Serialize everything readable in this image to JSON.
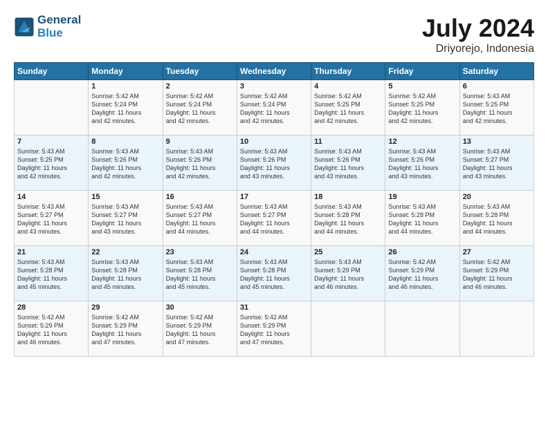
{
  "header": {
    "logo_line1": "General",
    "logo_line2": "Blue",
    "month_year": "July 2024",
    "location": "Driyorejo, Indonesia"
  },
  "days_of_week": [
    "Sunday",
    "Monday",
    "Tuesday",
    "Wednesday",
    "Thursday",
    "Friday",
    "Saturday"
  ],
  "weeks": [
    [
      {
        "day": "",
        "info": ""
      },
      {
        "day": "1",
        "info": "Sunrise: 5:42 AM\nSunset: 5:24 PM\nDaylight: 11 hours\nand 42 minutes."
      },
      {
        "day": "2",
        "info": "Sunrise: 5:42 AM\nSunset: 5:24 PM\nDaylight: 11 hours\nand 42 minutes."
      },
      {
        "day": "3",
        "info": "Sunrise: 5:42 AM\nSunset: 5:24 PM\nDaylight: 11 hours\nand 42 minutes."
      },
      {
        "day": "4",
        "info": "Sunrise: 5:42 AM\nSunset: 5:25 PM\nDaylight: 11 hours\nand 42 minutes."
      },
      {
        "day": "5",
        "info": "Sunrise: 5:42 AM\nSunset: 5:25 PM\nDaylight: 11 hours\nand 42 minutes."
      },
      {
        "day": "6",
        "info": "Sunrise: 5:43 AM\nSunset: 5:25 PM\nDaylight: 11 hours\nand 42 minutes."
      }
    ],
    [
      {
        "day": "7",
        "info": "Sunrise: 5:43 AM\nSunset: 5:25 PM\nDaylight: 11 hours\nand 42 minutes."
      },
      {
        "day": "8",
        "info": "Sunrise: 5:43 AM\nSunset: 5:26 PM\nDaylight: 11 hours\nand 42 minutes."
      },
      {
        "day": "9",
        "info": "Sunrise: 5:43 AM\nSunset: 5:26 PM\nDaylight: 11 hours\nand 42 minutes."
      },
      {
        "day": "10",
        "info": "Sunrise: 5:43 AM\nSunset: 5:26 PM\nDaylight: 11 hours\nand 43 minutes."
      },
      {
        "day": "11",
        "info": "Sunrise: 5:43 AM\nSunset: 5:26 PM\nDaylight: 11 hours\nand 43 minutes."
      },
      {
        "day": "12",
        "info": "Sunrise: 5:43 AM\nSunset: 5:26 PM\nDaylight: 11 hours\nand 43 minutes."
      },
      {
        "day": "13",
        "info": "Sunrise: 5:43 AM\nSunset: 5:27 PM\nDaylight: 11 hours\nand 43 minutes."
      }
    ],
    [
      {
        "day": "14",
        "info": "Sunrise: 5:43 AM\nSunset: 5:27 PM\nDaylight: 11 hours\nand 43 minutes."
      },
      {
        "day": "15",
        "info": "Sunrise: 5:43 AM\nSunset: 5:27 PM\nDaylight: 11 hours\nand 43 minutes."
      },
      {
        "day": "16",
        "info": "Sunrise: 5:43 AM\nSunset: 5:27 PM\nDaylight: 11 hours\nand 44 minutes."
      },
      {
        "day": "17",
        "info": "Sunrise: 5:43 AM\nSunset: 5:27 PM\nDaylight: 11 hours\nand 44 minutes."
      },
      {
        "day": "18",
        "info": "Sunrise: 5:43 AM\nSunset: 5:28 PM\nDaylight: 11 hours\nand 44 minutes."
      },
      {
        "day": "19",
        "info": "Sunrise: 5:43 AM\nSunset: 5:28 PM\nDaylight: 11 hours\nand 44 minutes."
      },
      {
        "day": "20",
        "info": "Sunrise: 5:43 AM\nSunset: 5:28 PM\nDaylight: 11 hours\nand 44 minutes."
      }
    ],
    [
      {
        "day": "21",
        "info": "Sunrise: 5:43 AM\nSunset: 5:28 PM\nDaylight: 11 hours\nand 45 minutes."
      },
      {
        "day": "22",
        "info": "Sunrise: 5:43 AM\nSunset: 5:28 PM\nDaylight: 11 hours\nand 45 minutes."
      },
      {
        "day": "23",
        "info": "Sunrise: 5:43 AM\nSunset: 5:28 PM\nDaylight: 11 hours\nand 45 minutes."
      },
      {
        "day": "24",
        "info": "Sunrise: 5:43 AM\nSunset: 5:28 PM\nDaylight: 11 hours\nand 45 minutes."
      },
      {
        "day": "25",
        "info": "Sunrise: 5:43 AM\nSunset: 5:29 PM\nDaylight: 11 hours\nand 46 minutes."
      },
      {
        "day": "26",
        "info": "Sunrise: 5:42 AM\nSunset: 5:29 PM\nDaylight: 11 hours\nand 46 minutes."
      },
      {
        "day": "27",
        "info": "Sunrise: 5:42 AM\nSunset: 5:29 PM\nDaylight: 11 hours\nand 46 minutes."
      }
    ],
    [
      {
        "day": "28",
        "info": "Sunrise: 5:42 AM\nSunset: 5:29 PM\nDaylight: 11 hours\nand 46 minutes."
      },
      {
        "day": "29",
        "info": "Sunrise: 5:42 AM\nSunset: 5:29 PM\nDaylight: 11 hours\nand 47 minutes."
      },
      {
        "day": "30",
        "info": "Sunrise: 5:42 AM\nSunset: 5:29 PM\nDaylight: 11 hours\nand 47 minutes."
      },
      {
        "day": "31",
        "info": "Sunrise: 5:42 AM\nSunset: 5:29 PM\nDaylight: 11 hours\nand 47 minutes."
      },
      {
        "day": "",
        "info": ""
      },
      {
        "day": "",
        "info": ""
      },
      {
        "day": "",
        "info": ""
      }
    ]
  ]
}
